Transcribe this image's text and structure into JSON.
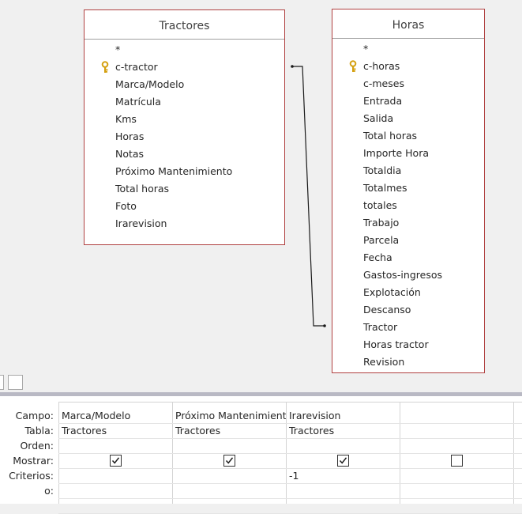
{
  "tables": [
    {
      "title": "Tractores",
      "fields": [
        "*",
        "c-tractor",
        "Marca/Modelo",
        "Matrícula",
        "Kms",
        "Horas",
        "Notas",
        "Próximo Mantenimiento",
        "Total horas",
        "Foto",
        "Irarevision"
      ],
      "key_field_index": 1
    },
    {
      "title": "Horas",
      "fields": [
        "*",
        "c-horas",
        "c-meses",
        "Entrada",
        "Salida",
        "Total horas",
        "Importe Hora",
        "Totaldia",
        "Totalmes",
        "totales",
        "Trabajo",
        "Parcela",
        "Fecha",
        "Gastos-ingresos",
        "Explotación",
        "Descanso",
        "Tractor",
        "Horas tractor",
        "Revision"
      ],
      "key_field_index": 1
    }
  ],
  "grid": {
    "row_labels": [
      "Campo:",
      "Tabla:",
      "Orden:",
      "Mostrar:",
      "Criterios:",
      "o:"
    ],
    "columns": [
      {
        "campo": "Marca/Modelo",
        "tabla": "Tractores",
        "orden": "",
        "mostrar": true,
        "criterios": "",
        "o": ""
      },
      {
        "campo": "Próximo Mantenimiento",
        "tabla": "Tractores",
        "orden": "",
        "mostrar": true,
        "criterios": "",
        "o": ""
      },
      {
        "campo": "Irarevision",
        "tabla": "Tractores",
        "orden": "",
        "mostrar": true,
        "criterios": "-1",
        "o": ""
      },
      {
        "campo": "",
        "tabla": "",
        "orden": "",
        "mostrar": false,
        "criterios": "",
        "o": ""
      }
    ]
  },
  "colors": {
    "table_border": "#b04040",
    "key_icon": "#e0b020",
    "splitter": "#b9b9c4"
  }
}
